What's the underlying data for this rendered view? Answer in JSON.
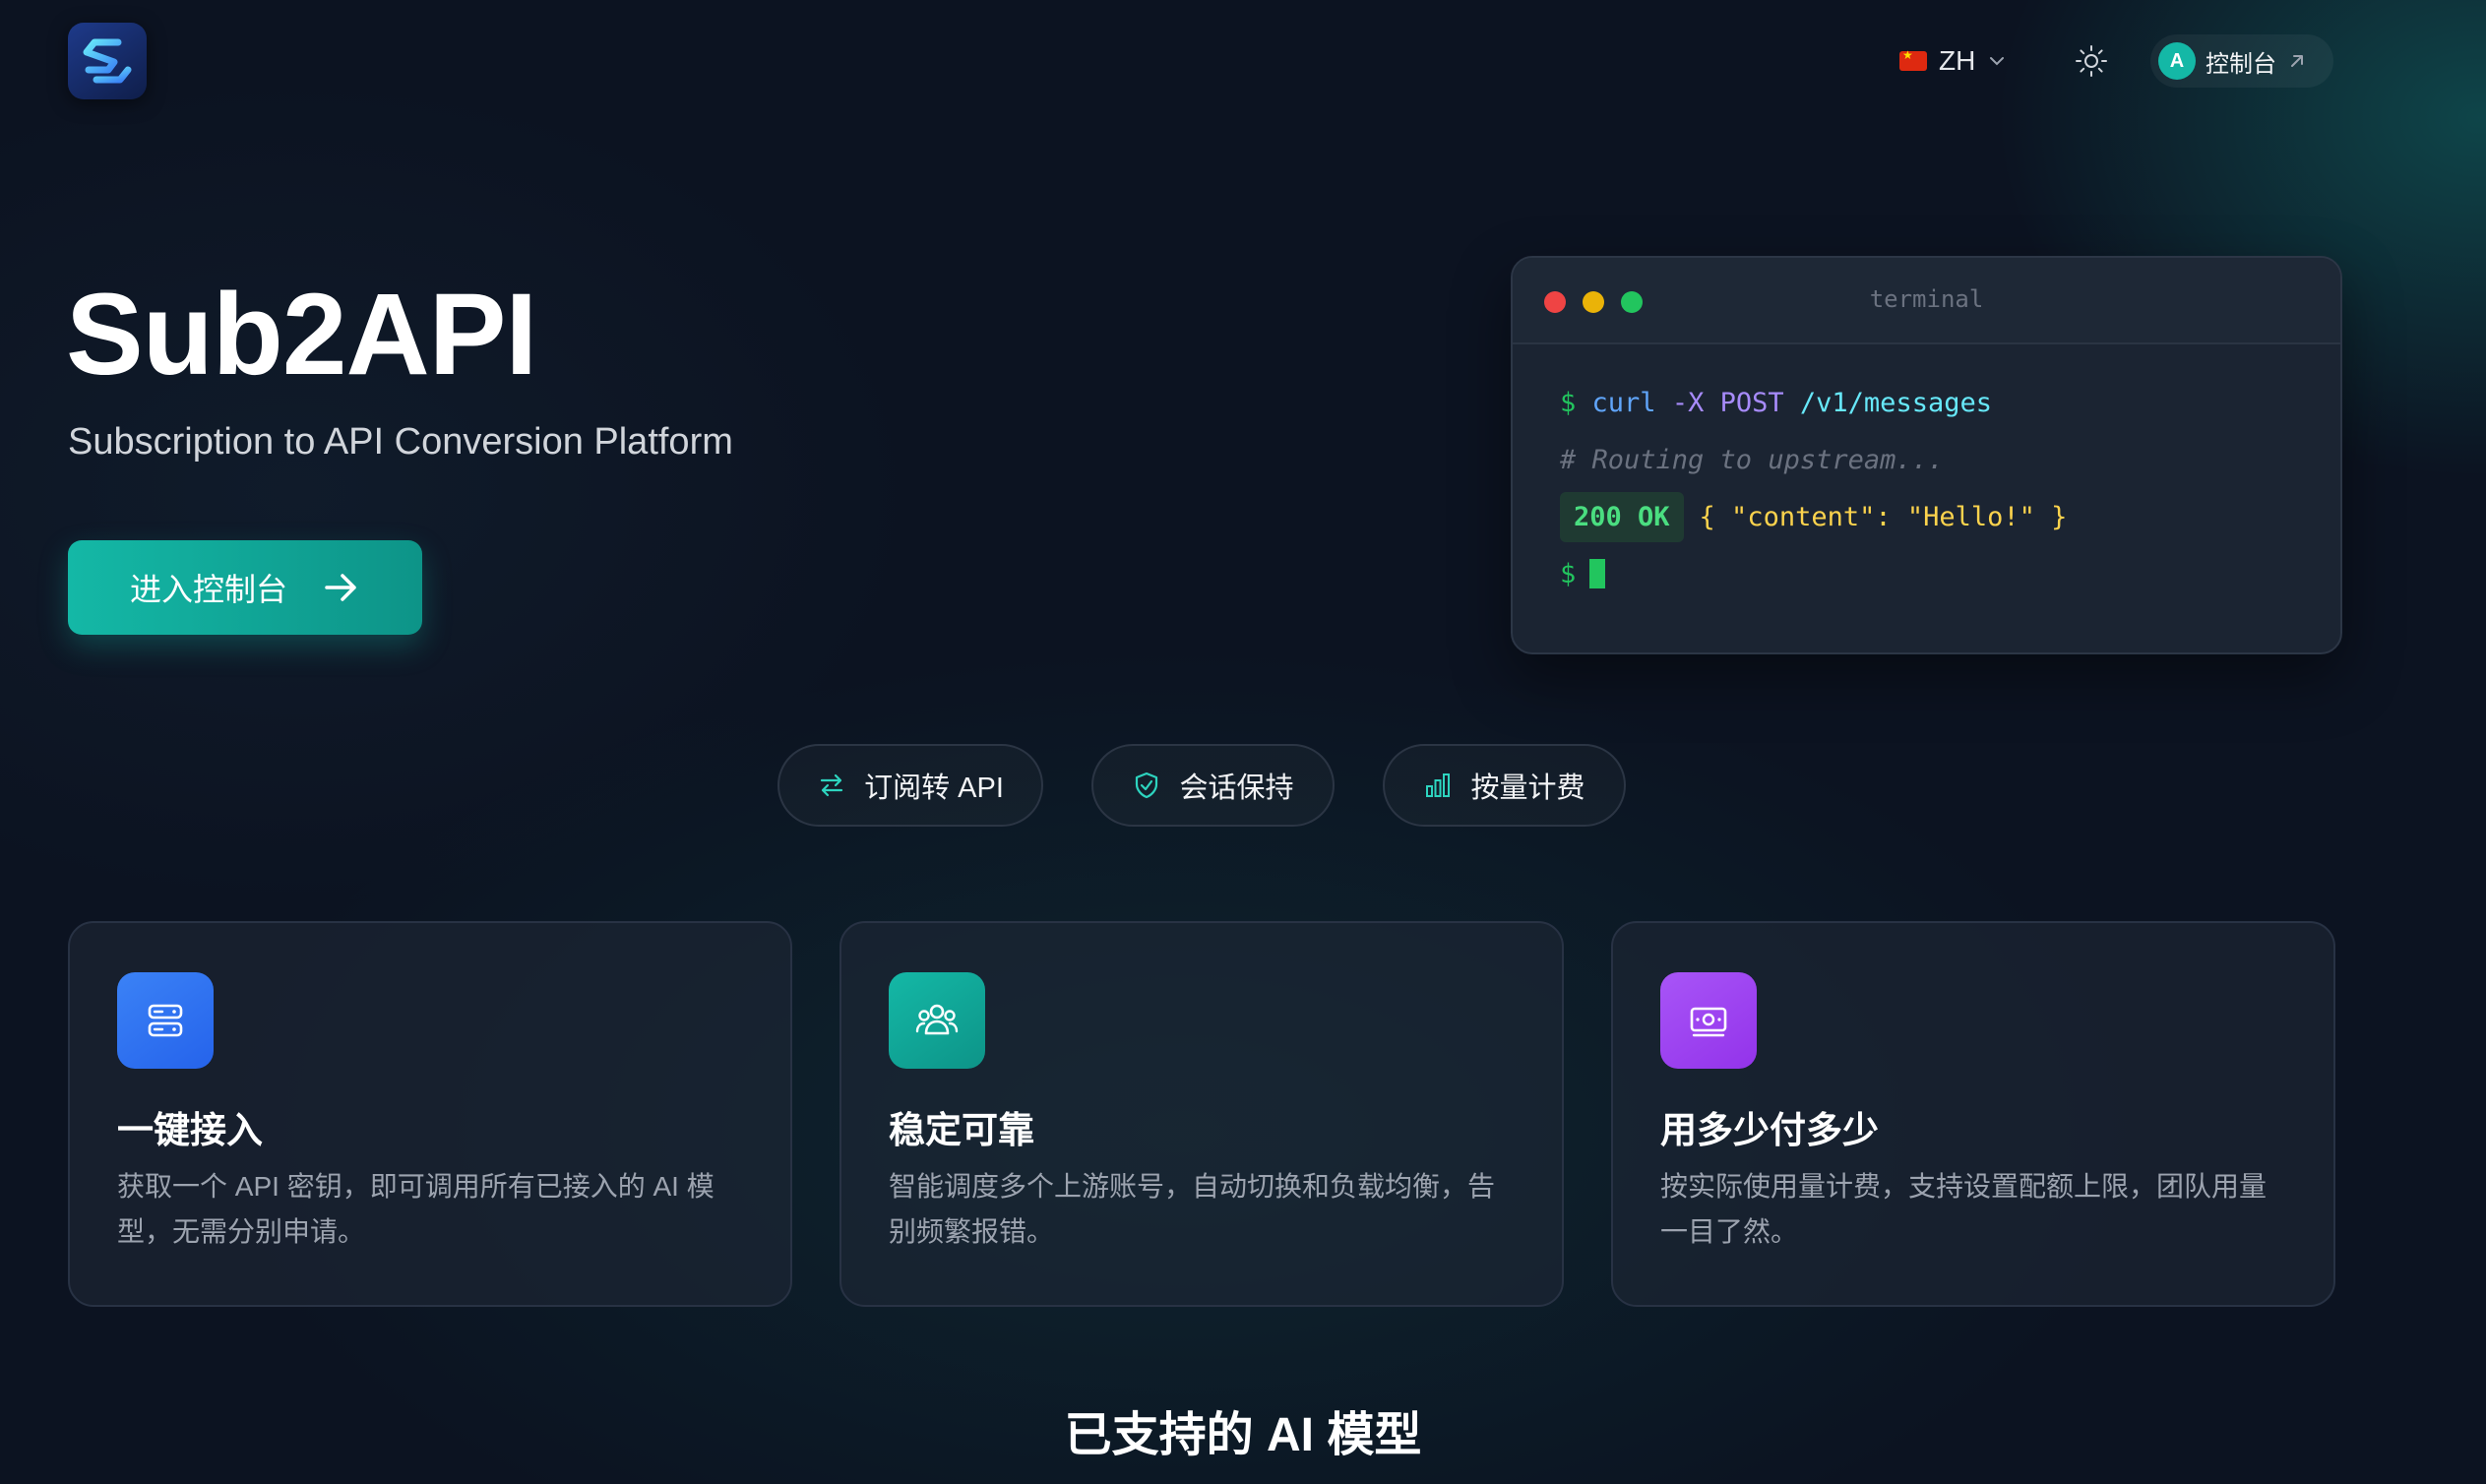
{
  "header": {
    "lang_code": "ZH",
    "console_avatar": "A",
    "console_label": "控制台"
  },
  "hero": {
    "title": "Sub2API",
    "subtitle": "Subscription to API Conversion Platform",
    "cta_label": "进入控制台"
  },
  "terminal": {
    "title": "terminal",
    "line1": {
      "prompt": "$",
      "cmd": "curl",
      "flag": "-X",
      "method": "POST",
      "path": "/v1/messages"
    },
    "line2": "# Routing to upstream...",
    "line3": {
      "status": "200 OK",
      "body": "{ \"content\": \"Hello!\" }"
    },
    "line4": "$"
  },
  "pills": [
    {
      "label": "订阅转 API",
      "icon": "swap-arrows-icon"
    },
    {
      "label": "会话保持",
      "icon": "shield-check-icon"
    },
    {
      "label": "按量计费",
      "icon": "bar-chart-icon"
    }
  ],
  "cards": [
    {
      "title": "一键接入",
      "desc": "获取一个 API 密钥，即可调用所有已接入的 AI 模型，无需分别申请。",
      "icon": "server-icon",
      "color": "#3b82f6"
    },
    {
      "title": "稳定可靠",
      "desc": "智能调度多个上游账号，自动切换和负载均衡，告别频繁报错。",
      "icon": "users-icon",
      "color": "#14b8a6"
    },
    {
      "title": "用多少付多少",
      "desc": "按实际使用量计费，支持设置配额上限，团队用量一目了然。",
      "icon": "money-icon",
      "color": "#a855f7"
    }
  ],
  "section_title": "已支持的 AI 模型",
  "colors": {
    "accent": "#14b8a6",
    "background": "#0c1321"
  }
}
